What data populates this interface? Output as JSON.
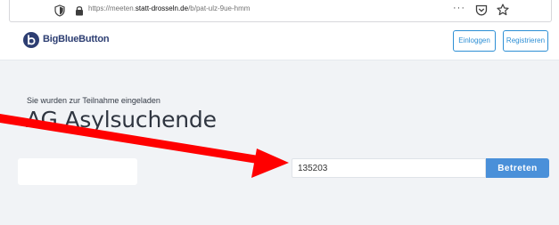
{
  "browser": {
    "url_prefix": "https://meeten.",
    "url_domain": "statt-drosseln.de",
    "url_path": "/b/pat-ulz-9ue-hmm",
    "more_label": "···"
  },
  "header": {
    "brand": "BigBlueButton",
    "login_label": "Einloggen",
    "register_label": "Registrieren"
  },
  "room": {
    "invite_text": "Sie wurden zur Teilnahme eingeladen",
    "title": "AG Asylsuchende",
    "access_code_value": "135203",
    "join_label": "Betreten"
  },
  "colors": {
    "brand": "#2d3e72",
    "accent": "#4a90d9",
    "annotation_arrow": "#ff0000"
  }
}
